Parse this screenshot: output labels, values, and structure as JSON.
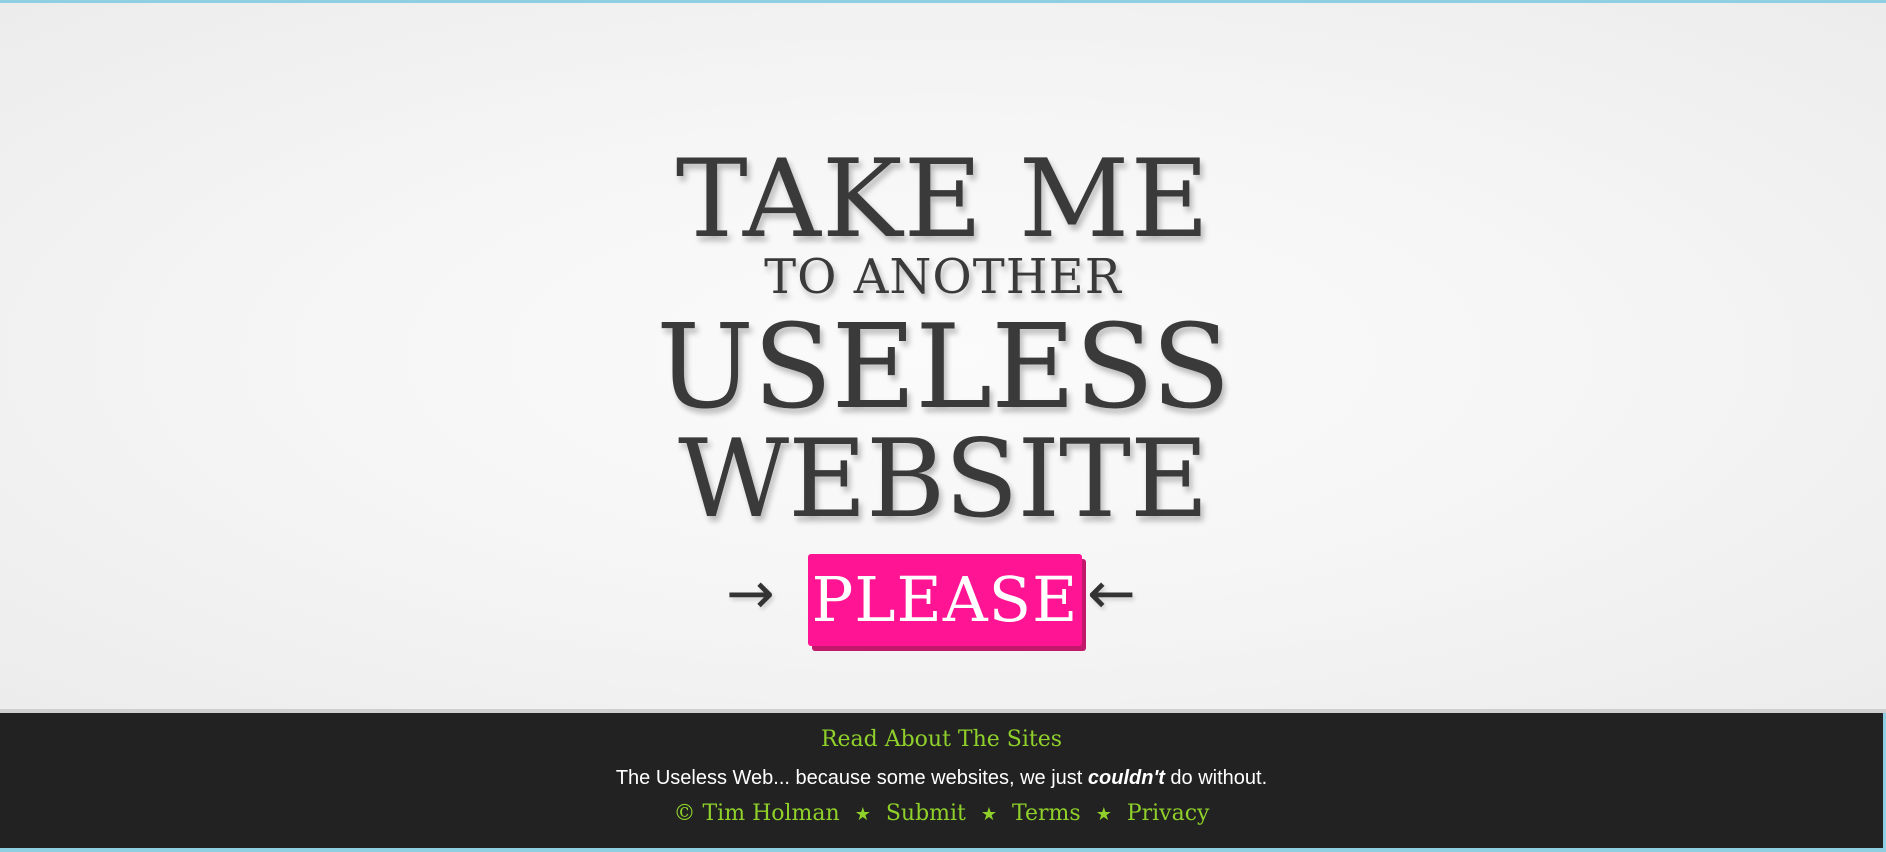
{
  "headline": {
    "line1": "TAKE ME",
    "line2": "TO ANOTHER",
    "line3": "USELESS",
    "line4": "WEBSITE"
  },
  "action": {
    "left_arrow_icon": "arrow-right-icon",
    "button_label": "PLEASE",
    "right_arrow_icon": "arrow-left-icon",
    "left_arrow_glyph": "→",
    "right_arrow_glyph": "←"
  },
  "footer": {
    "read_link": "Read About The Sites",
    "tagline_before": "The Useless Web... because some websites, we just ",
    "tagline_emphasis": "couldn't",
    "tagline_after": " do without.",
    "copyright_symbol": "©",
    "author_link": "Tim Holman",
    "separator": "★",
    "submit_link": "Submit",
    "terms_link": "Terms",
    "privacy_link": "Privacy"
  },
  "colors": {
    "button": "#ff1493",
    "link": "#8fd12a",
    "footer_bg": "#222222",
    "headline": "#3a3a3a"
  }
}
